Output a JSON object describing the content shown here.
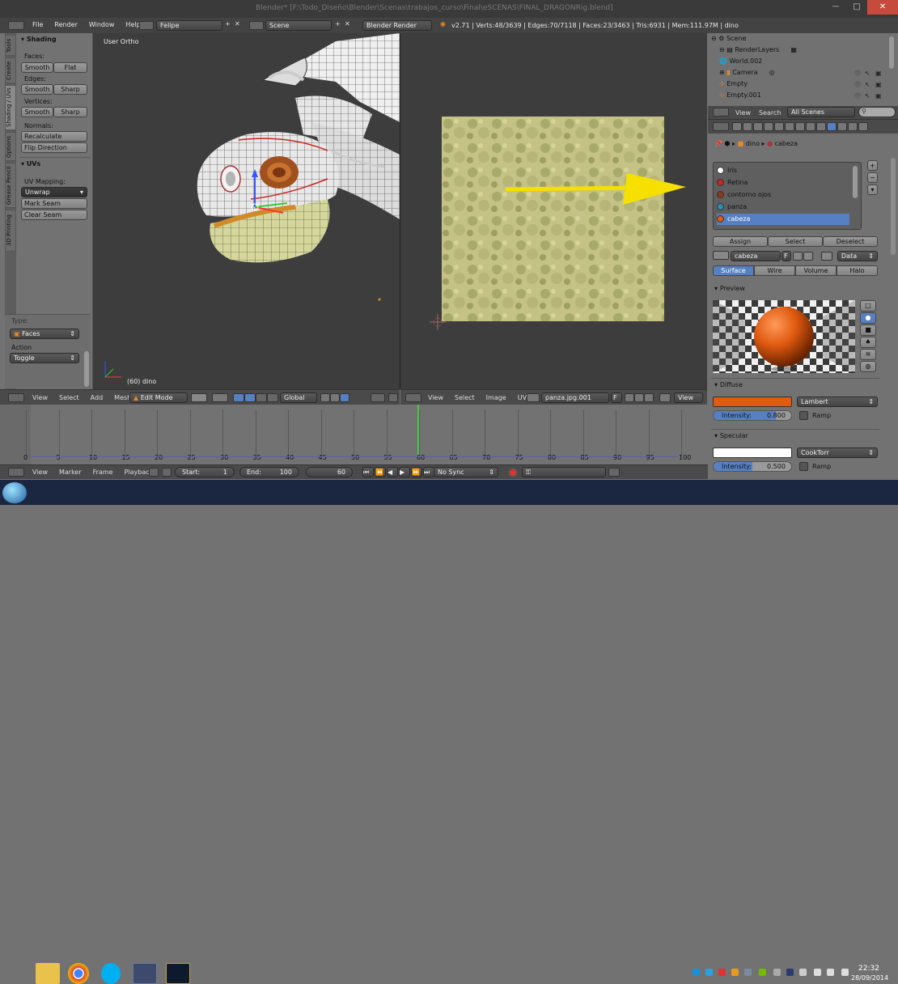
{
  "window": {
    "title": "Blender* [F:\\Todo_Diseño\\Blender\\Scenas\\trabajos_curso\\Final\\eSCENAS\\FINAL_DRAGONRig.blend]",
    "minimize": "—",
    "maximize": "□",
    "close": "✕"
  },
  "menubar": {
    "items": [
      "File",
      "Render",
      "Window",
      "Help"
    ],
    "layout": "Felipe",
    "scene": "Scene",
    "engine": "Blender Render",
    "stats": "v2.71 | Verts:48/3639 | Edges:70/7118 | Faces:23/3463 | Tris:6931 | Mem:111.97M | dino"
  },
  "toolshelf": {
    "tabs": [
      "Tools",
      "Create",
      "Shading / UVs",
      "Options",
      "Grease Pencil",
      "3D Printing"
    ],
    "shading_header": "Shading",
    "faces_label": "Faces:",
    "smooth": "Smooth",
    "flat": "Flat",
    "edges_label": "Edges:",
    "sharp": "Sharp",
    "vertices_label": "Vertices:",
    "normals_label": "Normals:",
    "recalculate": "Recalculate",
    "flip_direction": "Flip Direction",
    "uvs_header": "UVs",
    "uv_mapping_label": "UV Mapping:",
    "unwrap": "Unwrap",
    "mark_seam": "Mark Seam",
    "clear_seam": "Clear Seam",
    "type_label": "Type:",
    "type_value": "Faces",
    "action_label": "Action",
    "action_value": "Toggle"
  },
  "viewport": {
    "view_label": "User Ortho",
    "object_label": "(60) dino",
    "menu": [
      "View",
      "Select",
      "Add",
      "Mesh"
    ],
    "mode": "Edit Mode",
    "orientation": "Global"
  },
  "uv_editor": {
    "menu": [
      "View",
      "Select",
      "Image",
      "UVs"
    ],
    "image": "panza.jpg.001",
    "image_flag": "F",
    "view_label": "View"
  },
  "outliner": {
    "items": [
      {
        "label": "Scene",
        "indent": 0
      },
      {
        "label": "RenderLayers",
        "indent": 1
      },
      {
        "label": "World.002",
        "indent": 1
      },
      {
        "label": "Camera",
        "indent": 1
      },
      {
        "label": "Empty",
        "indent": 1
      },
      {
        "label": "Empty.001",
        "indent": 1
      }
    ],
    "menu": [
      "View",
      "Search"
    ],
    "filter": "All Scenes"
  },
  "properties": {
    "breadcrumb": [
      "dino",
      "cabeza"
    ],
    "materials": [
      {
        "name": "Iris",
        "color": "#ffffff"
      },
      {
        "name": "Retina",
        "color": "#cc2222"
      },
      {
        "name": "contorno ojos",
        "color": "#8b3a1a"
      },
      {
        "name": "panza",
        "color": "#2a8fb0"
      },
      {
        "name": "cabeza",
        "color": "#e05a10"
      }
    ],
    "selected_material": "cabeza",
    "assign": "Assign",
    "select": "Select",
    "deselect": "Deselect",
    "material_name": "cabeza",
    "material_flag": "F",
    "data_label": "Data",
    "tabs": [
      "Surface",
      "Wire",
      "Volume",
      "Halo"
    ],
    "active_tab": "Surface",
    "preview_header": "Preview",
    "diffuse_header": "Diffuse",
    "diffuse_color": "#e05a10",
    "diffuse_shader": "Lambert",
    "diffuse_intensity_label": "Intensity:",
    "diffuse_intensity": "0.800",
    "diffuse_intensity_fraction": 0.8,
    "ramp": "Ramp",
    "specular_header": "Specular",
    "specular_color": "#ffffff",
    "specular_shader": "CookTorr",
    "specular_intensity_label": "Intensity:",
    "specular_intensity": "0.500",
    "specular_intensity_fraction": 0.5
  },
  "timeline": {
    "ticks": [
      "0",
      "5",
      "10",
      "15",
      "20",
      "25",
      "30",
      "35",
      "40",
      "45",
      "50",
      "55",
      "60",
      "65",
      "70",
      "75",
      "80",
      "85",
      "90",
      "95",
      "100"
    ],
    "current_frame": 60,
    "menu": [
      "View",
      "Marker",
      "Frame",
      "Playback"
    ],
    "start_label": "Start:",
    "start": "1",
    "end_label": "End:",
    "end": "100",
    "frame": "60",
    "sync": "No Sync"
  },
  "taskbar": {
    "time": "22:32",
    "date": "28/09/2014"
  },
  "colors": {
    "accent": "#5680c2",
    "arrow": "#f5e000",
    "uv_timeline": "#44cc44"
  }
}
